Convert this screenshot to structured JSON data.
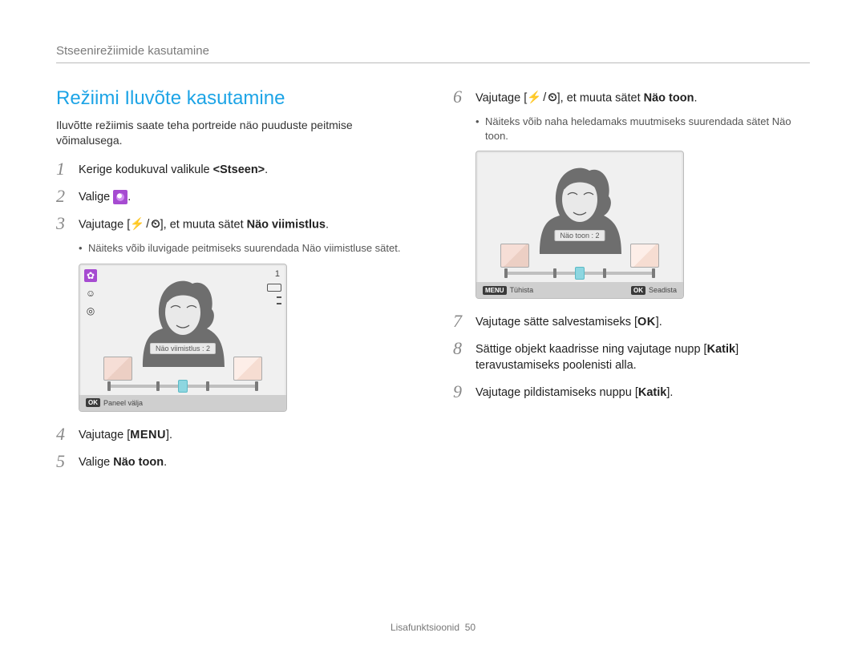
{
  "header": "Stseenirežiimide kasutamine",
  "left": {
    "title": "Režiimi Iluvõte kasutamine",
    "desc": "Iluvõtte režiimis saate teha portreide näo puuduste peitmise võimalusega.",
    "steps": [
      {
        "num": "1",
        "prefix": "Kerige kodukuval valikule ",
        "bold": "<Stseen>",
        "suffix": "."
      },
      {
        "num": "2",
        "prefix": "Valige ",
        "suffix": "."
      },
      {
        "num": "3",
        "prefix": "Vajutage [",
        "mid": "], et muuta sätet ",
        "bold": "Näo viimistlus",
        "suffix": ".",
        "bullet": "Näiteks võib iluvigade peitmiseks suurendada Näo viimistluse sätet."
      },
      {
        "num": "4",
        "prefix": "Vajutage [",
        "menu": "MENU",
        "suffix": "]."
      },
      {
        "num": "5",
        "prefix": "Valige ",
        "bold": "Näo toon",
        "suffix": "."
      }
    ],
    "lcd": {
      "badge": "Näo viimistlus : 2",
      "footer_ok": "OK",
      "footer_ok_label": "Paneel välja",
      "top_right_count": "1"
    }
  },
  "right": {
    "steps": [
      {
        "num": "6",
        "prefix": "Vajutage [",
        "mid": "], et muuta sätet ",
        "bold": "Näo toon",
        "suffix": ".",
        "bullet": "Näiteks võib naha heledamaks muutmiseks suurendada sätet Näo toon."
      },
      {
        "num": "7",
        "prefix": "Vajutage sätte salvestamiseks [",
        "ok": "OK",
        "suffix": "]."
      },
      {
        "num": "8",
        "prefix": "Sättige objekt kaadrisse ning vajutage nupp [",
        "bold": "Katik",
        "suffix": "] teravustamiseks poolenisti alla."
      },
      {
        "num": "9",
        "prefix": "Vajutage pildistamiseks nuppu [",
        "bold": "Katik",
        "suffix": "]."
      }
    ],
    "lcd": {
      "badge": "Näo toon : 2",
      "footer_menu": "MENU",
      "footer_menu_label": "Tühista",
      "footer_ok": "OK",
      "footer_ok_label": "Seadista"
    }
  },
  "footer": {
    "label": "Lisafunktsioonid",
    "page": "50"
  }
}
